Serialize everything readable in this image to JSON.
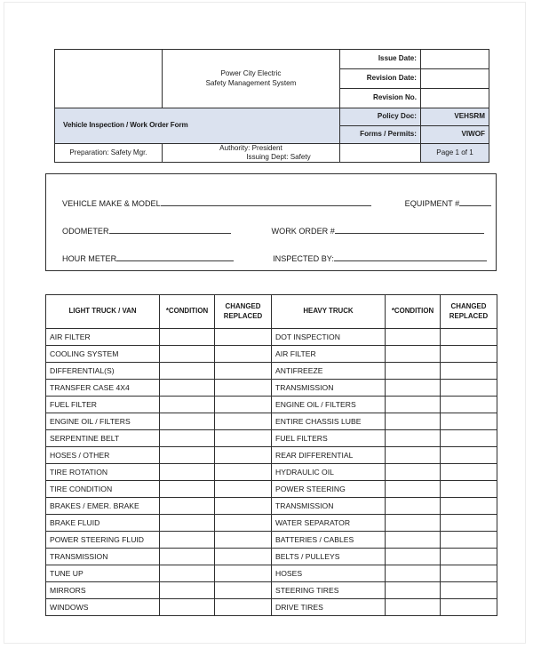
{
  "header": {
    "logo_cell": "",
    "company_line1": "Power City Electric",
    "company_line2": "Safety Management System",
    "issue_date_label": "Issue Date:",
    "issue_date_value": "",
    "revision_date_label": "Revision Date:",
    "revision_date_value": "",
    "revision_no_label": "Revision No.",
    "revision_no_value": "",
    "title": "Vehicle Inspection / Work Order Form",
    "policy_doc_label": "Policy Doc:",
    "policy_doc_value": "VEHSRM",
    "forms_permits_label": "Forms / Permits:",
    "forms_permits_value": "VIWOF",
    "preparation": "Preparation: Safety Mgr.",
    "authority": "Authority: President",
    "issuing_dept": "Issuing Dept: Safety",
    "footer_blank": "",
    "page_number": "Page 1 of 1",
    "shade_color": "#dbe2ef"
  },
  "vehicle_info": {
    "make_model_label": "VEHICLE MAKE & MODEL",
    "make_model_value": "",
    "equipment_label": "EQUIPMENT #",
    "equipment_value": "",
    "odometer_label": "ODOMETER",
    "odometer_value": "",
    "work_order_label": "WORK ORDER #",
    "work_order_value": "",
    "hour_meter_label": "HOUR METER",
    "hour_meter_value": "",
    "inspected_by_label": "INSPECTED BY:",
    "inspected_by_value": ""
  },
  "inspection_table": {
    "columns": [
      "LIGHT TRUCK / VAN",
      "*CONDITION",
      "CHANGED REPLACED",
      "HEAVY TRUCK",
      "*CONDITION",
      "CHANGED REPLACED"
    ],
    "column_header_lines": {
      "changed_replaced_line1": "CHANGED",
      "changed_replaced_line2": "REPLACED"
    },
    "light_truck_items": [
      "AIR FILTER",
      "COOLING SYSTEM",
      "DIFFERENTIAL(S)",
      "TRANSFER CASE 4X4",
      "FUEL FILTER",
      "ENGINE OIL / FILTERS",
      "SERPENTINE BELT",
      "HOSES / OTHER",
      "TIRE ROTATION",
      "TIRE CONDITION",
      "BRAKES / EMER. BRAKE",
      "BRAKE FLUID",
      "POWER STEERING FLUID",
      "TRANSMISSION",
      "TUNE UP",
      "MIRRORS",
      "WINDOWS"
    ],
    "heavy_truck_items": [
      "DOT INSPECTION",
      "AIR FILTER",
      "ANTIFREEZE",
      "TRANSMISSION",
      "ENGINE OIL / FILTERS",
      "ENTIRE CHASSIS LUBE",
      "FUEL FILTERS",
      "REAR DIFFERENTIAL",
      "HYDRAULIC OIL",
      "POWER STEERING",
      "TRANSMISSION",
      "WATER SEPARATOR",
      "BATTERIES / CABLES",
      "BELTS / PULLEYS",
      "HOSES",
      "STEERING TIRES",
      "DRIVE TIRES"
    ]
  }
}
